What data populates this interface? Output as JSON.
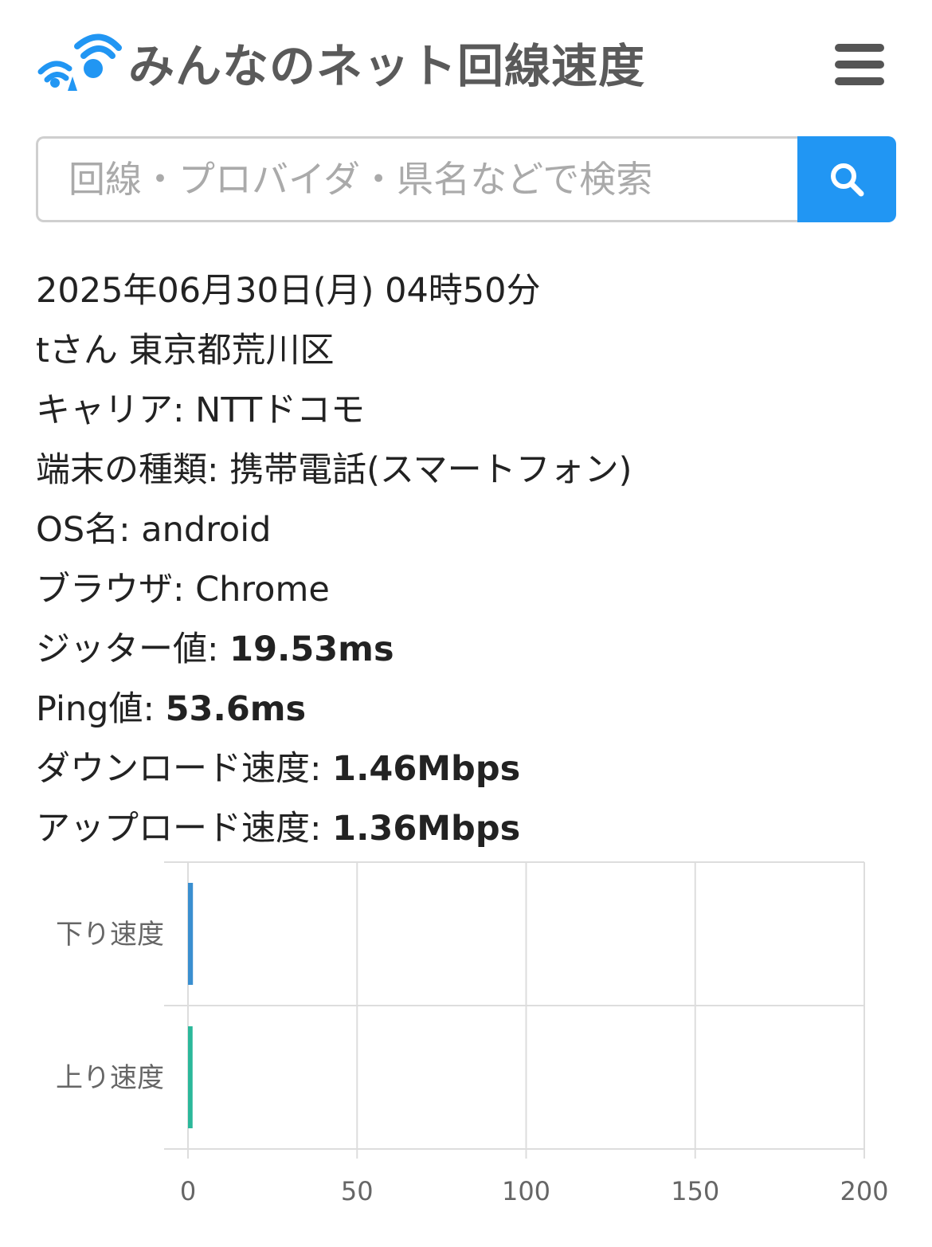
{
  "brand": {
    "title": "みんなのネット回線速度",
    "logo_icon": "wifi-signal-logo-icon",
    "accent_color": "#2196f3"
  },
  "menu": {
    "icon": "hamburger-menu-icon"
  },
  "search": {
    "placeholder": "回線・プロバイダ・県名などで検索",
    "value": "",
    "button_icon": "search-icon"
  },
  "result": {
    "datetime": "2025年06月30日(月) 04時50分",
    "user": "tさん 東京都荒川区",
    "carrier_label": "キャリア: ",
    "carrier_value": "NTTドコモ",
    "device_label": "端末の種類: ",
    "device_value": "携帯電話(スマートフォン)",
    "os_label": "OS名: ",
    "os_value": "android",
    "browser_label": "ブラウザ: ",
    "browser_value": "Chrome",
    "jitter_label": "ジッター値: ",
    "jitter_value": "19.53ms",
    "ping_label": "Ping値: ",
    "ping_value": "53.6ms",
    "download_label": "ダウンロード速度: ",
    "download_value": "1.46Mbps",
    "upload_label": "アップロード速度: ",
    "upload_value": "1.36Mbps"
  },
  "chart_data": {
    "type": "bar",
    "orientation": "horizontal",
    "categories": [
      "下り速度",
      "上り速度"
    ],
    "values": [
      1.46,
      1.36
    ],
    "colors": [
      "#3a8fd0",
      "#2bb89a"
    ],
    "xlim": [
      0,
      200
    ],
    "xticks": [
      "0",
      "50",
      "100",
      "150",
      "200"
    ],
    "grid": true
  }
}
